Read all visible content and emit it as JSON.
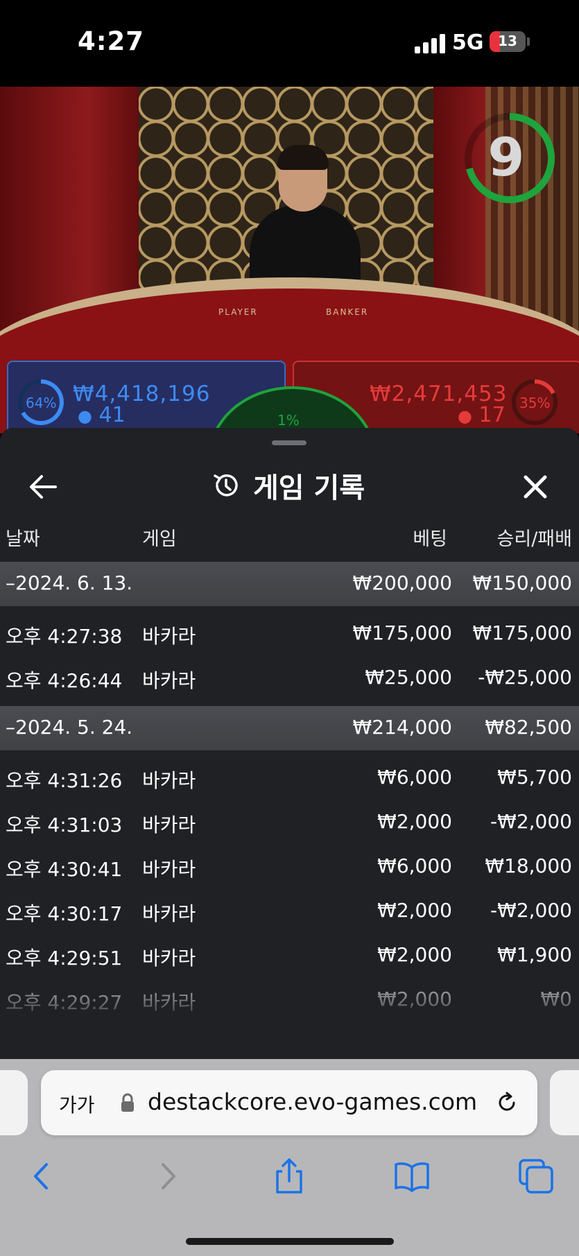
{
  "status_bar": {
    "time": "4:27",
    "network": "5G",
    "battery": "13"
  },
  "game_view": {
    "timer": "9",
    "table_words": {
      "player": "PLAYER",
      "banker": "BANKER"
    },
    "player": {
      "percent": "64%",
      "amount": "₩4,418,196",
      "count": "41"
    },
    "tie": {
      "percent": "1%"
    },
    "banker": {
      "percent": "35%",
      "amount": "₩2,471,453",
      "count": "17"
    },
    "colors": {
      "player": "#3d8bf2",
      "banker": "#e63a3a",
      "tie": "#1fa33c"
    }
  },
  "sheet": {
    "title": "게임 기록",
    "icons": {
      "back": "arrow-left-icon",
      "history": "history-icon",
      "close": "close-icon"
    },
    "columns": {
      "date": "날짜",
      "game": "게임",
      "bet": "베팅",
      "win_loss": "승리/패배"
    },
    "groups": [
      {
        "date": "–2024. 6. 13.",
        "bet_total": "₩200,000",
        "win_total": "₩150,000",
        "rows": [
          {
            "time": "오후 4:27:38",
            "game": "바카라",
            "bet": "₩175,000",
            "win": "₩175,000"
          },
          {
            "time": "오후 4:26:44",
            "game": "바카라",
            "bet": "₩25,000",
            "win": "-₩25,000"
          }
        ]
      },
      {
        "date": "–2024. 5. 24.",
        "bet_total": "₩214,000",
        "win_total": "₩82,500",
        "rows": [
          {
            "time": "오후 4:31:26",
            "game": "바카라",
            "bet": "₩6,000",
            "win": "₩5,700"
          },
          {
            "time": "오후 4:31:03",
            "game": "바카라",
            "bet": "₩2,000",
            "win": "-₩2,000"
          },
          {
            "time": "오후 4:30:41",
            "game": "바카라",
            "bet": "₩6,000",
            "win": "₩18,000"
          },
          {
            "time": "오후 4:30:17",
            "game": "바카라",
            "bet": "₩2,000",
            "win": "-₩2,000"
          },
          {
            "time": "오후 4:29:51",
            "game": "바카라",
            "bet": "₩2,000",
            "win": "₩1,900"
          },
          {
            "time": "오후 4:29:27",
            "game": "바카라",
            "bet": "₩2,000",
            "win": "₩0"
          }
        ]
      }
    ]
  },
  "browser": {
    "text_size_label": "가가",
    "url": "destackcore.evo-games.com",
    "toolbar_icons": [
      "back-icon",
      "forward-icon",
      "share-icon",
      "bookmarks-icon",
      "tabs-icon"
    ],
    "accent_color": "#1a73e8"
  }
}
